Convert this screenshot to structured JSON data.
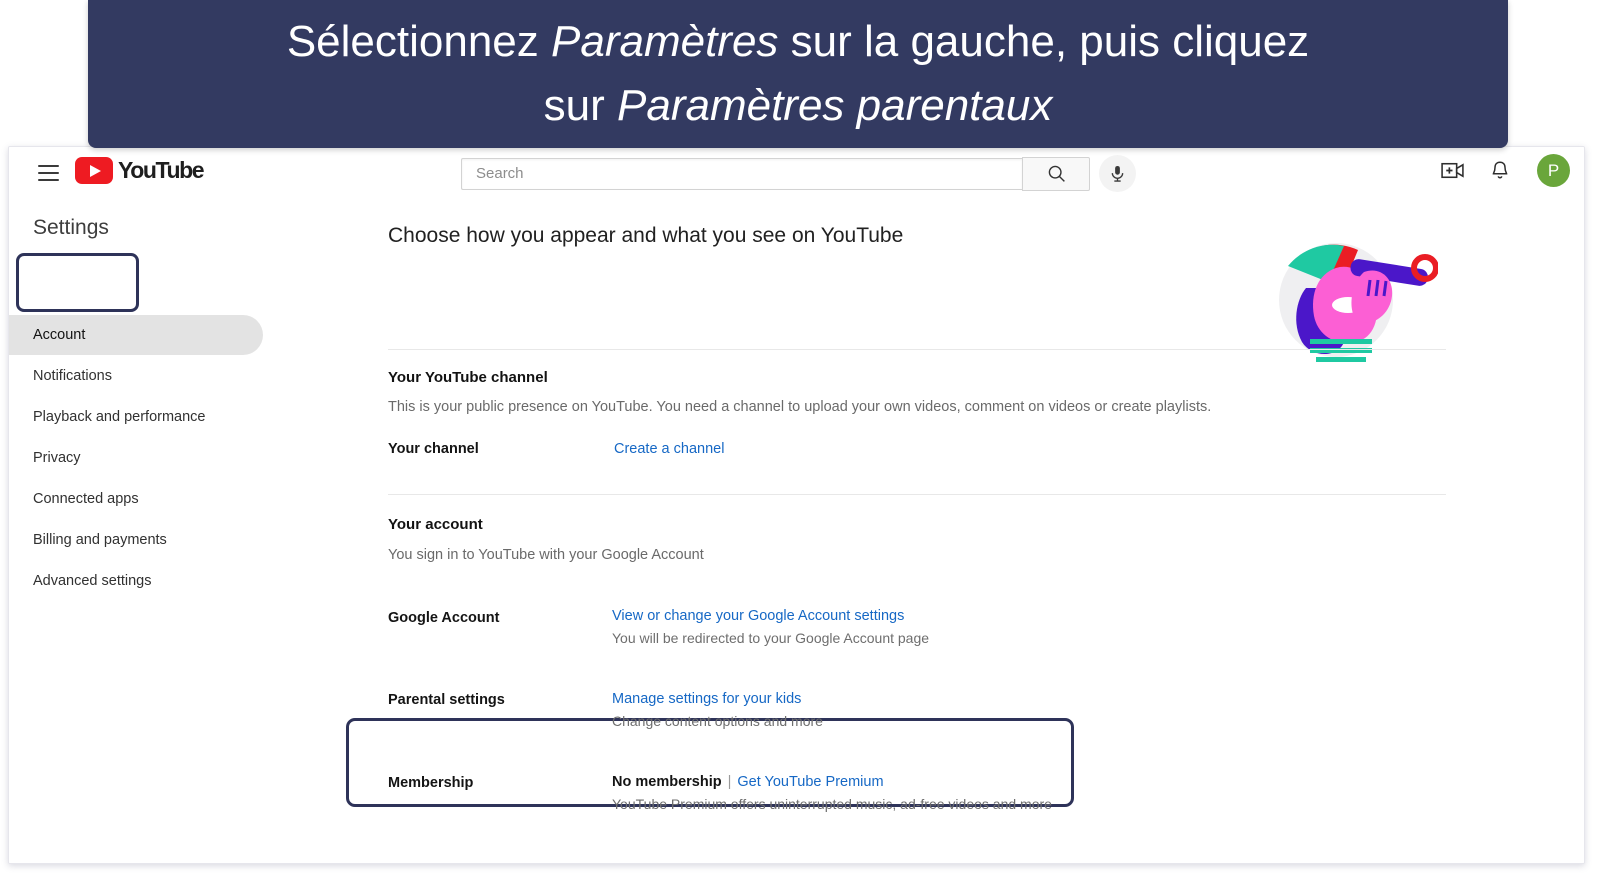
{
  "banner": {
    "line1_before": "Sélectionnez ",
    "line1_emphasis": "Paramètres",
    "line1_after": " sur la gauche, puis cliquez",
    "line2_before": "sur ",
    "line2_emphasis": "Paramètres parentaux",
    "background_color": "#333a61",
    "text_color": "#ffffff"
  },
  "masthead": {
    "logo_text": "YouTube",
    "hamburger_icon": "hamburger-menu-icon",
    "search": {
      "value": "",
      "placeholder": "Search",
      "submit_icon": "search-icon",
      "voice_icon": "microphone-icon"
    },
    "create_icon": "create-video-icon",
    "notifications_icon": "bell-icon",
    "avatar_initial": "P",
    "avatar_color": "#6aa63b"
  },
  "sidebar": {
    "title": "Settings",
    "highlight_color": "#2e3359",
    "items": [
      {
        "label": "Account",
        "active": true
      },
      {
        "label": "Notifications",
        "active": false
      },
      {
        "label": "Playback and performance",
        "active": false
      },
      {
        "label": "Privacy",
        "active": false
      },
      {
        "label": "Connected apps",
        "active": false
      },
      {
        "label": "Billing and payments",
        "active": false
      },
      {
        "label": "Advanced settings",
        "active": false
      }
    ]
  },
  "main": {
    "heading": "Choose how you appear and what you see on YouTube",
    "illustration": "person-with-telescope-illustration",
    "channel_section": {
      "title": "Your YouTube channel",
      "description": "This is your public presence on YouTube. You need a channel to upload your own videos, comment on videos or create playlists.",
      "row_label": "Your channel",
      "row_link": "Create a channel"
    },
    "account_section": {
      "title": "Your account",
      "description": "You sign in to YouTube with your Google Account",
      "google_account": {
        "label": "Google Account",
        "link": "View or change your Google Account settings",
        "sub": "You will be redirected to your Google Account page"
      },
      "parental_settings": {
        "label": "Parental settings",
        "link": "Manage settings for your kids",
        "sub": "Change content options and more",
        "highlighted": true
      },
      "membership": {
        "label": "Membership",
        "status": "No membership",
        "separator": "|",
        "link": "Get YouTube Premium",
        "sub": "YouTube Premium offers uninterrupted music, ad-free videos and more"
      }
    }
  }
}
